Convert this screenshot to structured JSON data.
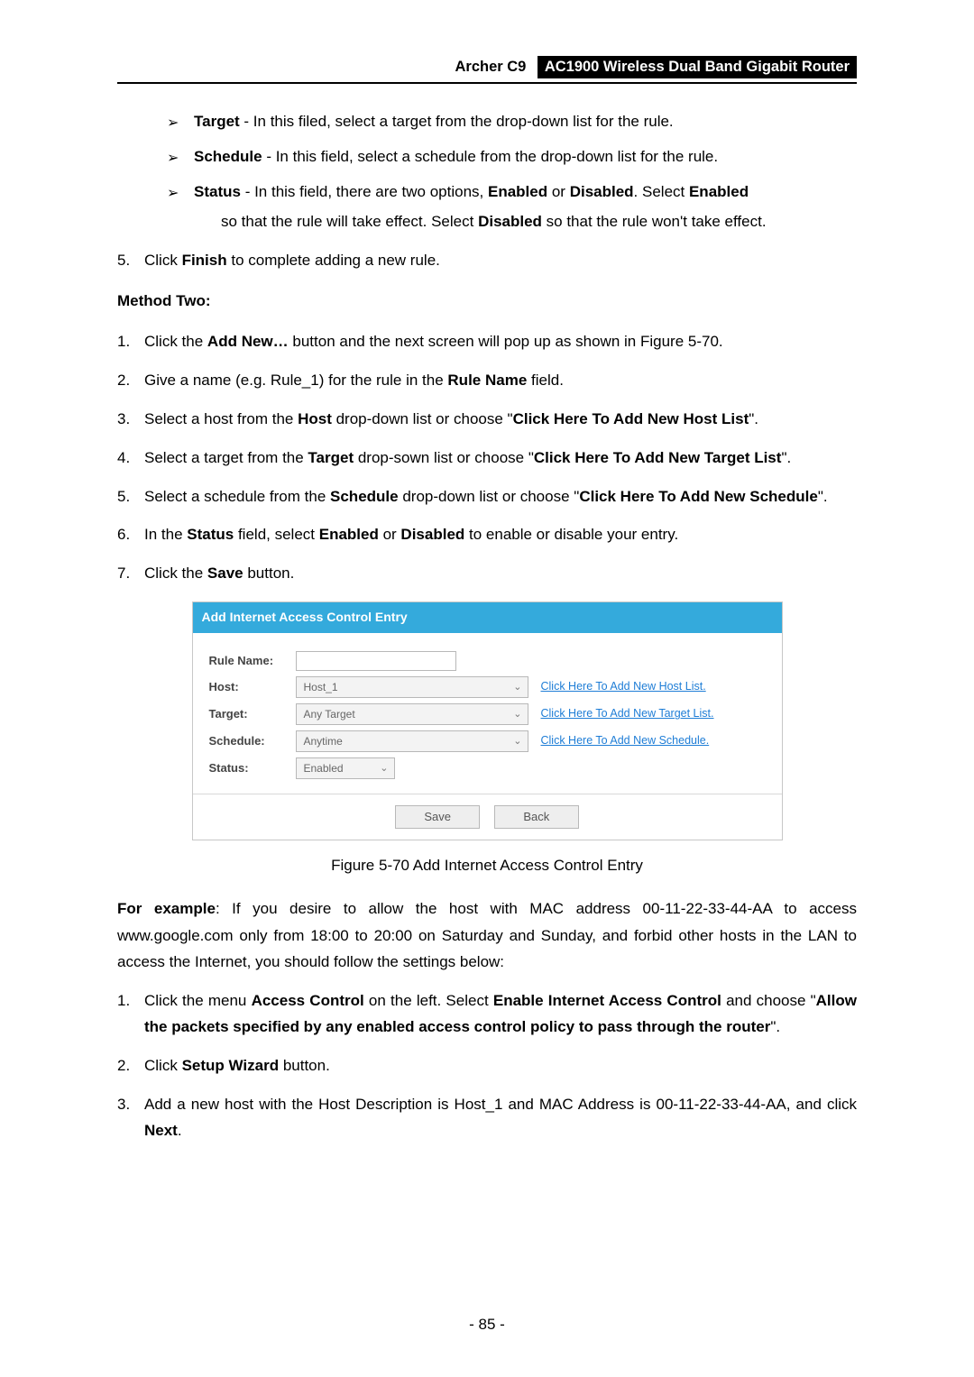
{
  "header": {
    "model": "Archer C9",
    "product": "AC1900 Wireless Dual Band Gigabit Router"
  },
  "bullets2": [
    {
      "label": "Target",
      "text": " - In this filed, select a target from the drop-down list for the rule."
    },
    {
      "label": "Schedule",
      "text": " - In this field, select a schedule from the drop-down list for the rule."
    },
    {
      "label": "Status",
      "text": " - In this field, there are two options, ",
      "b1": "Enabled",
      "mid1": " or ",
      "b2": "Disabled",
      "mid2": ". Select ",
      "b3": "Enabled",
      "cont": "so that the rule will take effect. Select ",
      "b4": "Disabled",
      "tail": " so that the rule won't take effect."
    }
  ],
  "step5": {
    "n": "5.",
    "pre": "Click ",
    "b": "Finish",
    "post": " to complete adding a new rule."
  },
  "methodTwo": "Method Two:",
  "m2steps": [
    {
      "n": "1.",
      "pre": "Click the ",
      "b": "Add New…",
      "post": " button and the next screen will pop up as shown in Figure 5-70."
    },
    {
      "n": "2.",
      "pre": "Give a name (e.g. Rule_1) for the rule in the ",
      "b": "Rule Name",
      "post": " field."
    },
    {
      "n": "3.",
      "pre": "Select a host from the ",
      "b": "Host",
      "mid": " drop-down list or choose \"",
      "b2": "Click Here To Add New Host List",
      "post": "\"."
    },
    {
      "n": "4.",
      "pre": "Select a target from the ",
      "b": "Target",
      "mid": " drop-sown list or choose \"",
      "b2": "Click Here To Add New Target List",
      "post": "\"."
    },
    {
      "n": "5.",
      "pre": "Select a schedule from the ",
      "b": "Schedule",
      "mid": " drop-down list or choose \"",
      "b2": "Click Here To Add New Schedule",
      "post": "\"."
    },
    {
      "n": "6.",
      "pre": "In the ",
      "b": "Status",
      "mid": " field, select ",
      "b2": "Enabled",
      "mid2": " or ",
      "b3": "Disabled",
      "post": " to enable or disable your entry."
    },
    {
      "n": "7.",
      "pre": "Click the ",
      "b": "Save",
      "post": " button."
    }
  ],
  "ui": {
    "title": "Add Internet Access Control Entry",
    "rows": {
      "rule": {
        "label": "Rule Name:"
      },
      "host": {
        "label": "Host:",
        "value": "Host_1",
        "link": "Click Here To Add New Host List."
      },
      "target": {
        "label": "Target:",
        "value": "Any Target",
        "link": "Click Here To Add New Target List."
      },
      "schedule": {
        "label": "Schedule:",
        "value": "Anytime",
        "link": "Click Here To Add New Schedule."
      },
      "status": {
        "label": "Status:",
        "value": "Enabled"
      }
    },
    "buttons": {
      "save": "Save",
      "back": "Back"
    }
  },
  "figureCaption": "Figure 5-70 Add Internet Access Control Entry",
  "example": {
    "lead": "For example",
    "text": ": If you desire to allow the host with MAC address 00-11-22-33-44-AA to access www.google.com only from 18:00 to 20:00 on Saturday and Sunday, and forbid other hosts in the LAN to access the Internet, you should follow the settings below:"
  },
  "exSteps": [
    {
      "n": "1.",
      "pre": "Click the menu ",
      "b": "Access Control",
      "mid": " on the left. Select ",
      "b2": "Enable Internet Access Control",
      "mid2": " and choose \"",
      "b3": "Allow the packets specified by any enabled access control policy to pass through the router",
      "post": "\"."
    },
    {
      "n": "2.",
      "pre": "Click ",
      "b": "Setup Wizard",
      "post": " button."
    },
    {
      "n": "3.",
      "pre": "Add a new host with the Host Description is Host_1 and MAC Address is 00-11-22-33-44-AA, and click ",
      "b": "Next",
      "post": "."
    }
  ],
  "pageNumber": "- 85 -"
}
